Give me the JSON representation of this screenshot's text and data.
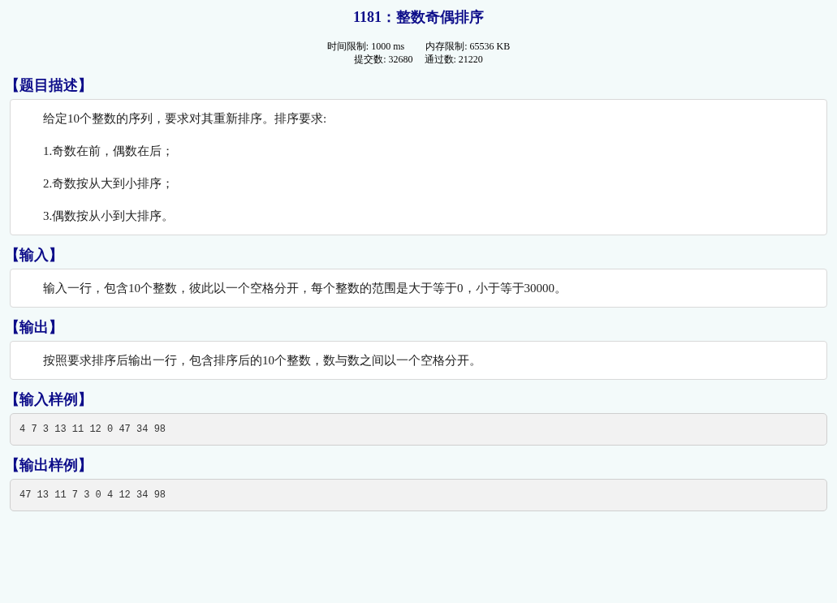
{
  "title": "1181：整数奇偶排序",
  "limits": [
    {
      "label": "时间限制: 1000 ms"
    },
    {
      "label": "内存限制: 65536 KB"
    }
  ],
  "stats": [
    {
      "label": "提交数: 32680"
    },
    {
      "label": "通过数: 21220"
    }
  ],
  "sections": [
    {
      "kind": "text",
      "heading": "【题目描述】",
      "paragraphs": [
        "给定10个整数的序列，要求对其重新排序。排序要求:",
        "1.奇数在前，偶数在后；",
        "2.奇数按从大到小排序；",
        "3.偶数按从小到大排序。"
      ]
    },
    {
      "kind": "text",
      "heading": "【输入】",
      "paragraphs": [
        "输入一行，包含10个整数，彼此以一个空格分开，每个整数的范围是大于等于0，小于等于30000。"
      ]
    },
    {
      "kind": "text",
      "heading": "【输出】",
      "paragraphs": [
        "按照要求排序后输出一行，包含排序后的10个整数，数与数之间以一个空格分开。"
      ]
    },
    {
      "kind": "code",
      "heading": "【输入样例】",
      "code": "4 7 3 13 11 12 0 47 34 98"
    },
    {
      "kind": "code",
      "heading": "【输出样例】",
      "code": "47 13 11 7 3 0 4 12 34 98"
    }
  ]
}
